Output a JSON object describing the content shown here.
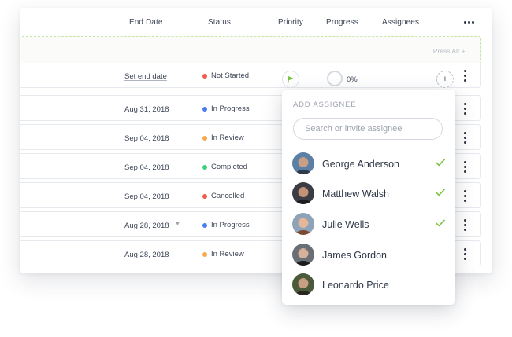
{
  "header": {
    "end_date": "End Date",
    "status": "Status",
    "priority": "Priority",
    "progress": "Progress",
    "assignees": "Assignees",
    "more_icon": "more-horizontal-icon"
  },
  "quick_add": {
    "hint": "Press Alt + T"
  },
  "status_colors": {
    "Not Started": "#ef5b4c",
    "In Progress": "#4a7bf0",
    "In Review": "#f6a84a",
    "Completed": "#3fcf74",
    "Cancelled": "#ef5b4c"
  },
  "rows": [
    {
      "end_date": "Set end date",
      "status": "Not Started"
    },
    {
      "end_date": "Aug 31, 2018",
      "status": "In Progress"
    },
    {
      "end_date": "Sep 04, 2018",
      "status": "In Review"
    },
    {
      "end_date": "Sep 04, 2018",
      "status": "Completed"
    },
    {
      "end_date": "Sep 04, 2018",
      "status": "Cancelled"
    },
    {
      "end_date": "Aug 28, 2018",
      "status": "In Progress"
    },
    {
      "end_date": "Aug 28, 2018",
      "status": "In Review"
    }
  ],
  "first_row": {
    "priority_icon": "flag-icon",
    "priority_color": "#7cc242",
    "progress": "0%",
    "add_assignee": "+"
  },
  "assignee_dropdown": {
    "title": "ADD ASSIGNEE",
    "search_placeholder": "Search or invite assignee",
    "check_color": "#7cc242",
    "people": [
      {
        "name": "George Anderson",
        "selected": true
      },
      {
        "name": "Matthew Walsh",
        "selected": true
      },
      {
        "name": "Julie Wells",
        "selected": true
      },
      {
        "name": "James Gordon",
        "selected": false
      },
      {
        "name": "Leonardo Price",
        "selected": false
      }
    ]
  }
}
